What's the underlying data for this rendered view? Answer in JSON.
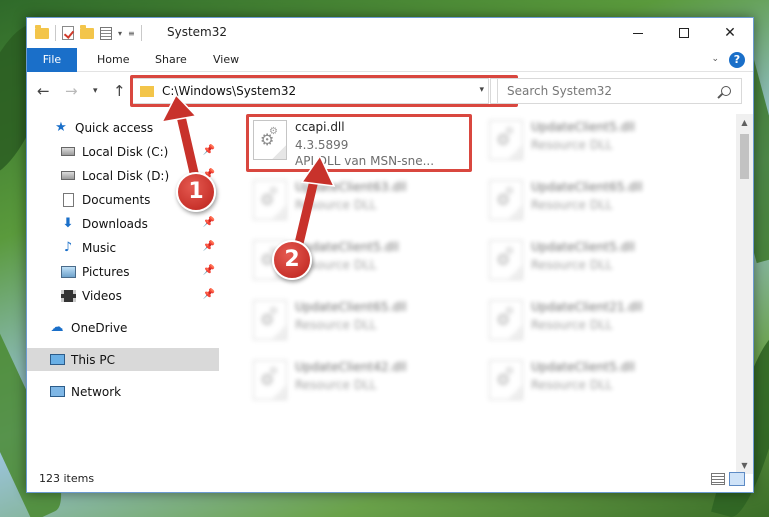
{
  "window": {
    "title": "System32",
    "controls": {
      "minimize": "–",
      "maximize": "□",
      "close": "✕"
    }
  },
  "ribbon": {
    "tabs": [
      "File",
      "Home",
      "Share",
      "View"
    ],
    "help": "?"
  },
  "address_bar": {
    "path": "C:\\Windows\\System32",
    "refresh": "↻"
  },
  "search": {
    "placeholder": "Search System32"
  },
  "sidebar": {
    "items": [
      {
        "label": "Quick access",
        "icon": "star-icon",
        "pinned": false
      },
      {
        "label": "Local Disk (C:)",
        "icon": "drive-icon",
        "pinned": true
      },
      {
        "label": "Local Disk (D:)",
        "icon": "drive-icon",
        "pinned": true
      },
      {
        "label": "Documents",
        "icon": "documents-icon",
        "pinned": true
      },
      {
        "label": "Downloads",
        "icon": "downloads-icon",
        "pinned": true
      },
      {
        "label": "Music",
        "icon": "music-icon",
        "pinned": true
      },
      {
        "label": "Pictures",
        "icon": "pictures-icon",
        "pinned": true
      },
      {
        "label": "Videos",
        "icon": "videos-icon",
        "pinned": true
      },
      {
        "label": "OneDrive",
        "icon": "cloud-icon"
      },
      {
        "label": "This PC",
        "icon": "computer-icon",
        "selected": true
      },
      {
        "label": "Network",
        "icon": "network-icon"
      }
    ]
  },
  "files": [
    {
      "name": "ccapi.dll",
      "line2": "4.3.5899",
      "line3": "API DLL van MSN-sne...",
      "highlighted": true
    },
    {
      "name": "UpdateClient5.dll",
      "line2": "Resource DLL"
    },
    {
      "name": "UpdateClient63.dll",
      "line2": "Resource DLL"
    },
    {
      "name": "UpdateClient65.dll",
      "line2": "Resource DLL"
    },
    {
      "name": "UpdateClient5.dll",
      "line2": "Resource DLL"
    },
    {
      "name": "UpdateClient5.dll",
      "line2": "Resource DLL"
    },
    {
      "name": "UpdateClient65.dll",
      "line2": "Resource DLL"
    },
    {
      "name": "UpdateClient21.dll",
      "line2": "Resource DLL"
    },
    {
      "name": "UpdateClient42.dll",
      "line2": "Resource DLL"
    },
    {
      "name": "UpdateClient5.dll",
      "line2": "Resource DLL"
    }
  ],
  "status": {
    "item_count": "123 items"
  },
  "annotations": {
    "step1": "1",
    "step2": "2"
  },
  "colors": {
    "accent": "#1a6fc9",
    "highlight": "#d9473f",
    "selected": "#d9d9d9"
  }
}
